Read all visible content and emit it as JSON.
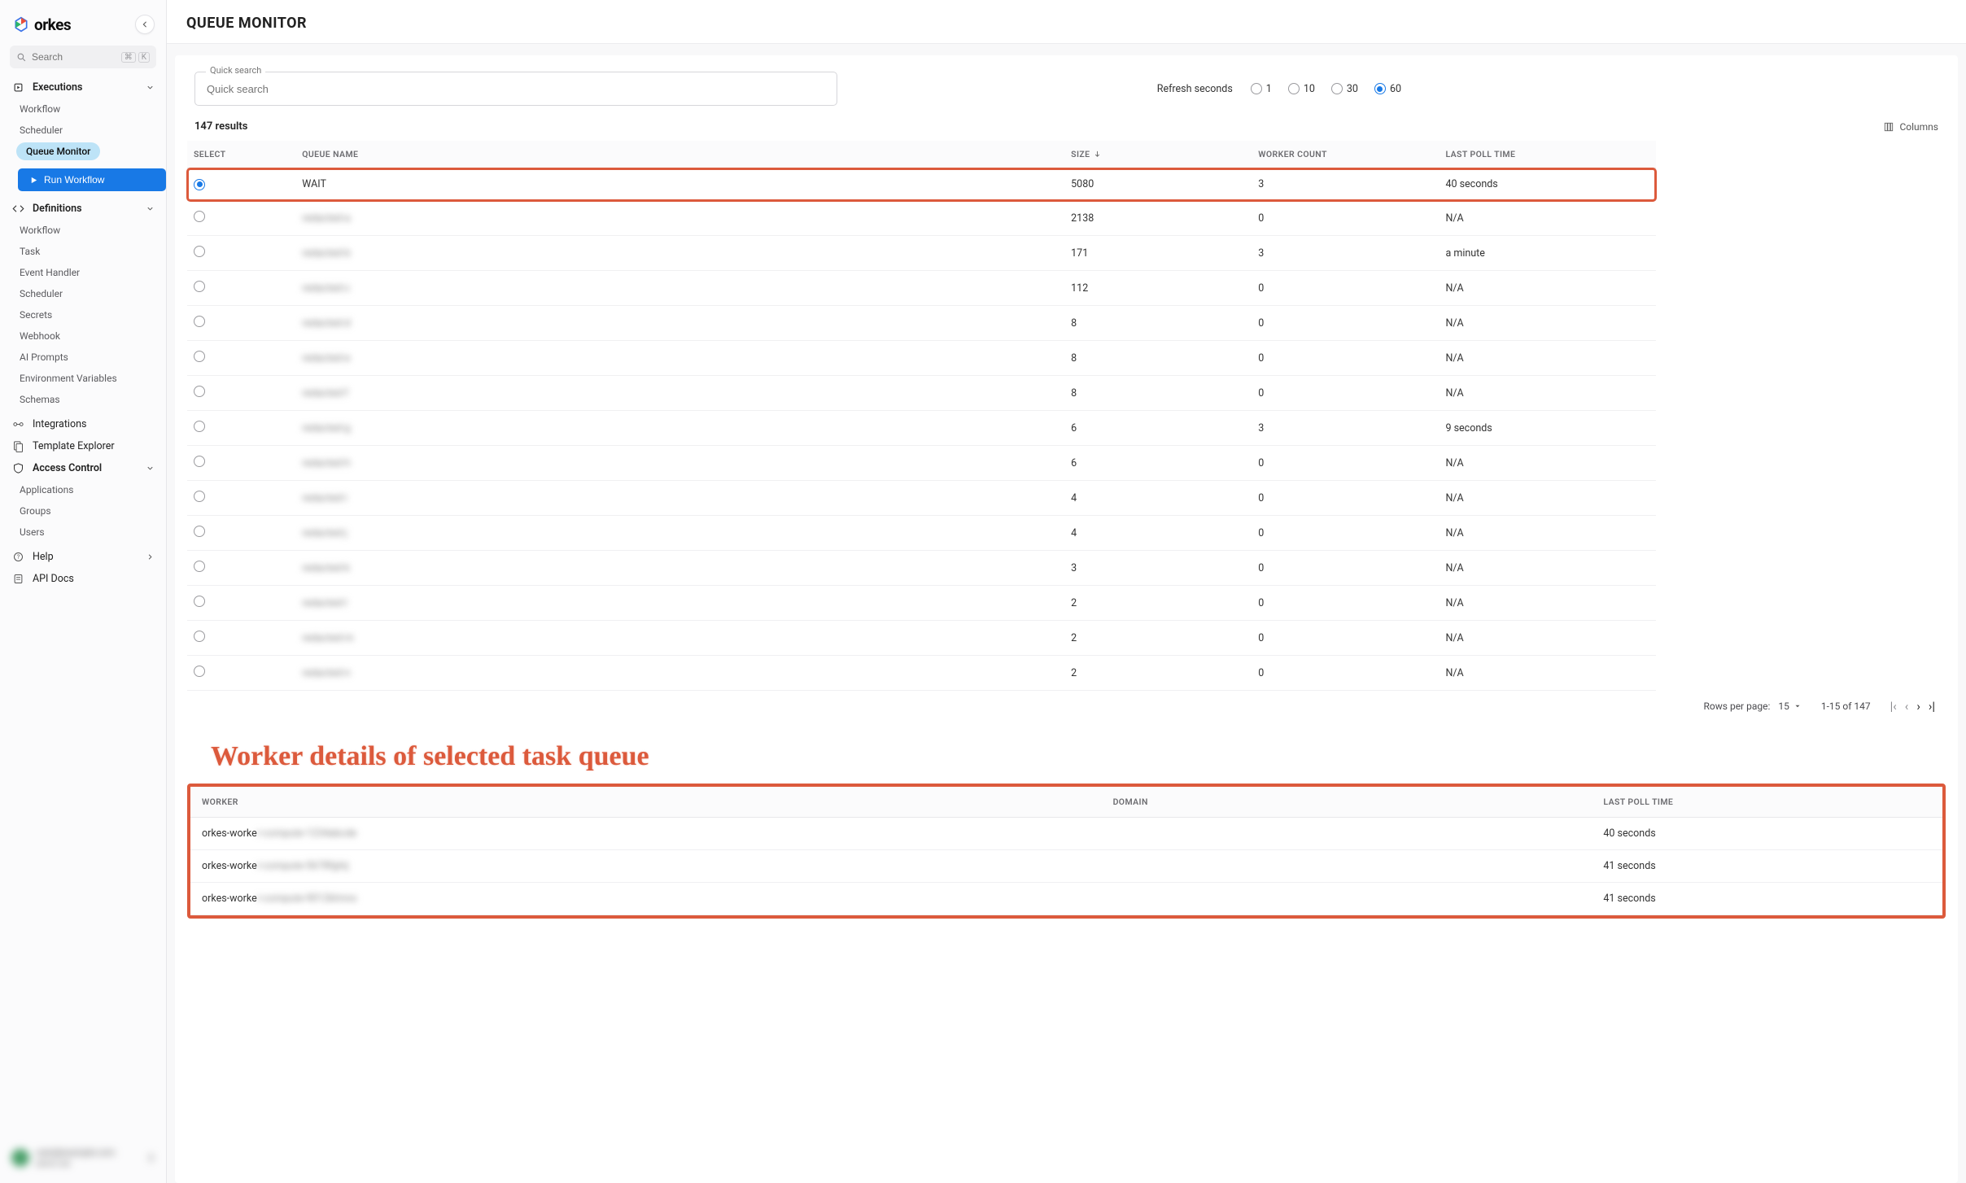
{
  "logo": {
    "text": "orkes"
  },
  "sidebar": {
    "search_placeholder": "Search",
    "sections": {
      "executions": {
        "title": "Executions",
        "items": [
          "Workflow",
          "Scheduler",
          "Queue Monitor"
        ]
      },
      "definitions": {
        "title": "Definitions",
        "items": [
          "Workflow",
          "Task",
          "Event Handler",
          "Scheduler",
          "Secrets",
          "Webhook",
          "AI Prompts",
          "Environment Variables",
          "Schemas"
        ]
      },
      "access": {
        "title": "Access Control",
        "items": [
          "Applications",
          "Groups",
          "Users"
        ]
      }
    },
    "run_workflow": "Run Workflow",
    "integrations": "Integrations",
    "template_explorer": "Template Explorer",
    "help": "Help",
    "api_docs": "API Docs"
  },
  "page": {
    "title": "QUEUE MONITOR",
    "quick_search_label": "Quick search",
    "quick_search_ph": "Quick search",
    "refresh_label": "Refresh seconds",
    "refresh_opts": [
      "1",
      "10",
      "30",
      "60"
    ],
    "refresh_selected": "60",
    "results_label": "147 results",
    "columns_label": "Columns"
  },
  "table": {
    "headers": {
      "select": "SELECT",
      "name": "QUEUE NAME",
      "size": "SIZE",
      "workers": "WORKER COUNT",
      "poll": "LAST POLL TIME"
    },
    "rows": [
      {
        "selected": true,
        "name": "WAIT",
        "blurred": false,
        "size": "5080",
        "workers": "3",
        "poll": "40 seconds"
      },
      {
        "selected": false,
        "name": "redacted-a",
        "blurred": true,
        "size": "2138",
        "workers": "0",
        "poll": "N/A"
      },
      {
        "selected": false,
        "name": "redacted-b",
        "blurred": true,
        "size": "171",
        "workers": "3",
        "poll": "a minute"
      },
      {
        "selected": false,
        "name": "redacted-c",
        "blurred": true,
        "size": "112",
        "workers": "0",
        "poll": "N/A"
      },
      {
        "selected": false,
        "name": "redacted-d",
        "blurred": true,
        "size": "8",
        "workers": "0",
        "poll": "N/A"
      },
      {
        "selected": false,
        "name": "redacted-e",
        "blurred": true,
        "size": "8",
        "workers": "0",
        "poll": "N/A"
      },
      {
        "selected": false,
        "name": "redacted-f",
        "blurred": true,
        "size": "8",
        "workers": "0",
        "poll": "N/A"
      },
      {
        "selected": false,
        "name": "redacted-g",
        "blurred": true,
        "size": "6",
        "workers": "3",
        "poll": "9 seconds"
      },
      {
        "selected": false,
        "name": "redacted-h",
        "blurred": true,
        "size": "6",
        "workers": "0",
        "poll": "N/A"
      },
      {
        "selected": false,
        "name": "redacted-i",
        "blurred": true,
        "size": "4",
        "workers": "0",
        "poll": "N/A"
      },
      {
        "selected": false,
        "name": "redacted-j",
        "blurred": true,
        "size": "4",
        "workers": "0",
        "poll": "N/A"
      },
      {
        "selected": false,
        "name": "redacted-k",
        "blurred": true,
        "size": "3",
        "workers": "0",
        "poll": "N/A"
      },
      {
        "selected": false,
        "name": "redacted-l",
        "blurred": true,
        "size": "2",
        "workers": "0",
        "poll": "N/A"
      },
      {
        "selected": false,
        "name": "redacted-m",
        "blurred": true,
        "size": "2",
        "workers": "0",
        "poll": "N/A"
      },
      {
        "selected": false,
        "name": "redacted-n",
        "blurred": true,
        "size": "2",
        "workers": "0",
        "poll": "N/A"
      }
    ]
  },
  "pagination": {
    "rows_per_page_label": "Rows per page:",
    "rows_per_page": "15",
    "range": "1-15 of 147"
  },
  "annotation": "Worker details of selected task queue",
  "workers": {
    "headers": {
      "worker": "WORKER",
      "domain": "DOMAIN",
      "poll": "LAST POLL TIME"
    },
    "rows": [
      {
        "visible": "orkes-worke",
        "hidden": "r-compute-1234abcde",
        "domain": "",
        "poll": "40 seconds"
      },
      {
        "visible": "orkes-worke",
        "hidden": "r-compute-5678fghij",
        "domain": "",
        "poll": "41 seconds"
      },
      {
        "visible": "orkes-worke",
        "hidden": "r-compute-9012klmno",
        "domain": "",
        "poll": "41 seconds"
      }
    ]
  }
}
